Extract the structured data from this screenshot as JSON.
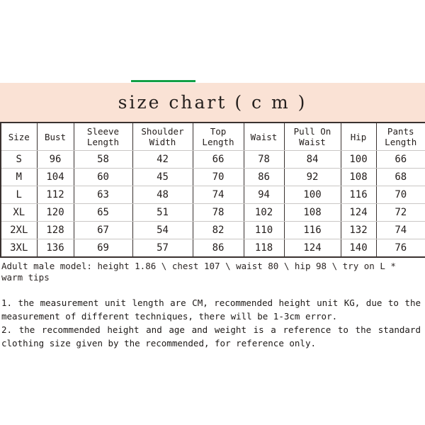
{
  "banner": {
    "title": "size chart ( c m )",
    "accent_color": "#12a046",
    "background_color": "#fae2d5"
  },
  "table": {
    "headers": [
      {
        "line1": "Size",
        "line2": ""
      },
      {
        "line1": "Bust",
        "line2": ""
      },
      {
        "line1": "Sleeve",
        "line2": "Length"
      },
      {
        "line1": "Shoulder",
        "line2": "Width"
      },
      {
        "line1": "Top",
        "line2": "Length"
      },
      {
        "line1": "Waist",
        "line2": ""
      },
      {
        "line1": "Pull On",
        "line2": "Waist"
      },
      {
        "line1": "Hip",
        "line2": ""
      },
      {
        "line1": "Pants",
        "line2": "Length"
      }
    ],
    "rows": [
      {
        "size": "S",
        "bust": "96",
        "sleeve_length": "58",
        "shoulder_width": "42",
        "top_length": "66",
        "waist": "78",
        "pull_on_waist": "84",
        "hip": "100",
        "pants_length": "66"
      },
      {
        "size": "M",
        "bust": "104",
        "sleeve_length": "60",
        "shoulder_width": "45",
        "top_length": "70",
        "waist": "86",
        "pull_on_waist": "92",
        "hip": "108",
        "pants_length": "68"
      },
      {
        "size": "L",
        "bust": "112",
        "sleeve_length": "63",
        "shoulder_width": "48",
        "top_length": "74",
        "waist": "94",
        "pull_on_waist": "100",
        "hip": "116",
        "pants_length": "70"
      },
      {
        "size": "XL",
        "bust": "120",
        "sleeve_length": "65",
        "shoulder_width": "51",
        "top_length": "78",
        "waist": "102",
        "pull_on_waist": "108",
        "hip": "124",
        "pants_length": "72"
      },
      {
        "size": "2XL",
        "bust": "128",
        "sleeve_length": "67",
        "shoulder_width": "54",
        "top_length": "82",
        "waist": "110",
        "pull_on_waist": "116",
        "hip": "132",
        "pants_length": "74"
      },
      {
        "size": "3XL",
        "bust": "136",
        "sleeve_length": "69",
        "shoulder_width": "57",
        "top_length": "86",
        "waist": "118",
        "pull_on_waist": "124",
        "hip": "140",
        "pants_length": "76"
      }
    ]
  },
  "model_note": "Adult male model: height 1.86 \\ chest 107 \\ waist 80 \\ hip 98 \\ try on L * warm tips",
  "notes": [
    "1. the measurement unit length are CM, recommended height unit KG, due to the measurement of different techniques, there will be 1-3cm error.",
    "2. the recommended height and age and weight is a reference to the standard clothing size given by the recommended, for reference only."
  ]
}
